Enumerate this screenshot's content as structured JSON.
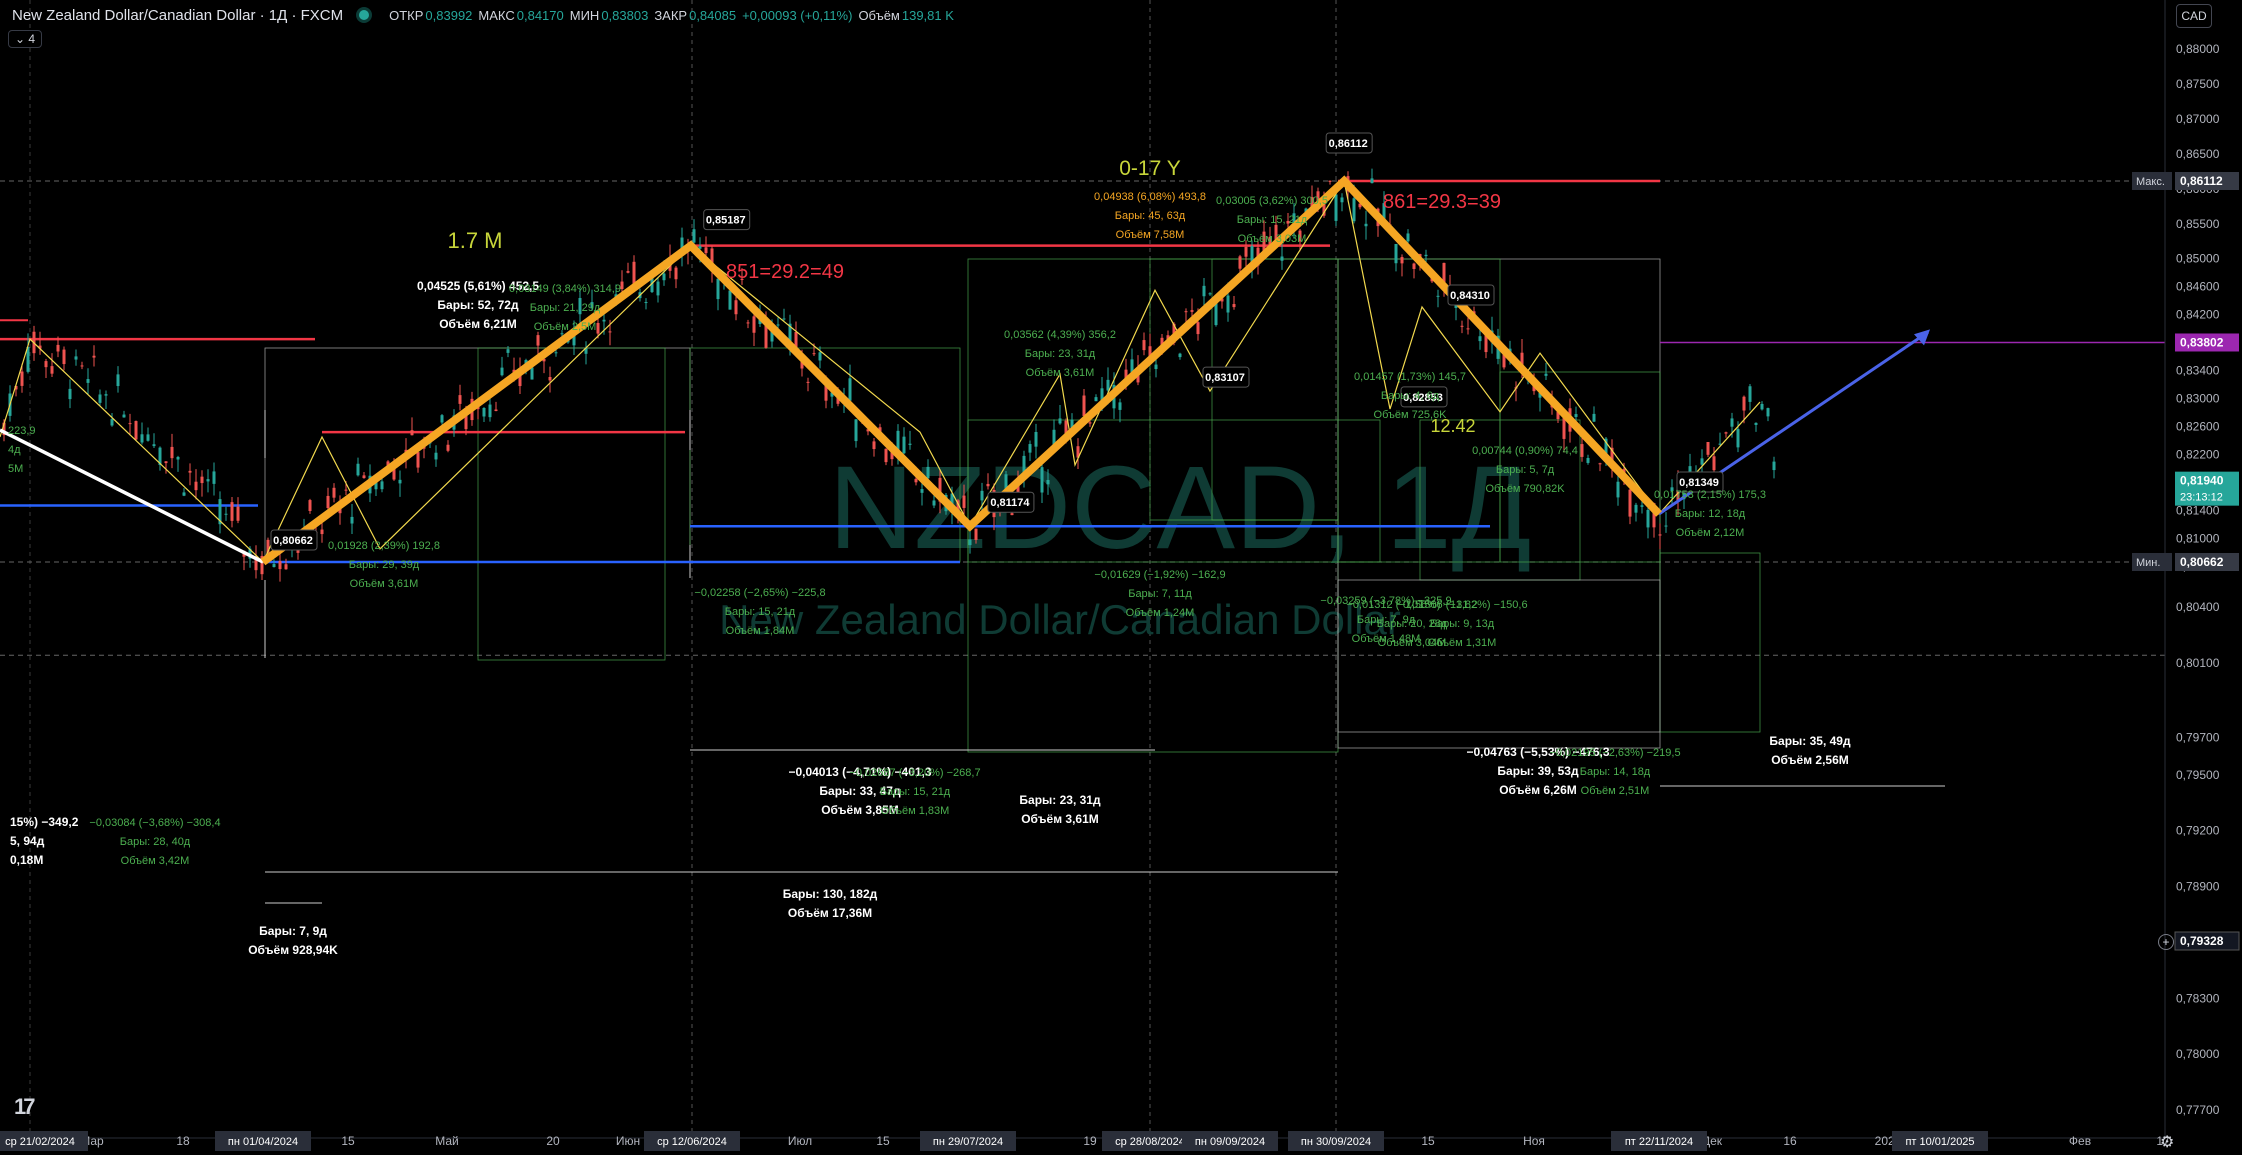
{
  "header": {
    "title": "New Zealand Dollar/Canadian Dollar · 1Д · FXCM",
    "open_label": "ОТКР",
    "open": "0,83992",
    "high_label": "МАКС",
    "high": "0,84170",
    "low_label": "МИН",
    "low": "0,83803",
    "close_label": "ЗАКР",
    "close": "0,84085",
    "change": "+0,00093 (+0,11%)",
    "volume_label": "Объём",
    "volume": "139,81 K",
    "collapse": "⌄ 4"
  },
  "currency_button": "CAD",
  "watermark": {
    "symbol": "NZDCAD, 1Д",
    "name": "New Zealand Dollar/Canadian Dollar"
  },
  "colors": {
    "zigzag": "#f5a623",
    "red_level": "#f23645",
    "blue_level": "#2962ff",
    "green": "#26a69a",
    "label_green": "#4caf50",
    "purple": "#9c27b0"
  },
  "chart_data": {
    "type": "line",
    "title": "",
    "xlabel": "",
    "ylabel": "",
    "ylim": [
      0.7705,
      0.8935
    ],
    "grid": false,
    "price_ticks": [
      "0,88000",
      "0,87500",
      "0,87000",
      "0,86500",
      "0,86000",
      "0,85500",
      "0,85000",
      "0,84600",
      "0,84200",
      "0,83800",
      "0,83400",
      "0,83000",
      "0,82600",
      "0,82200",
      "0,81800",
      "0,81400",
      "0,81000",
      "0,80600",
      "0,80400",
      "0,80100",
      "0,79700",
      "0,79500",
      "0,79200",
      "0,78900",
      "0,78600",
      "0,78300",
      "0,78000",
      "0,77700"
    ],
    "price_badges": [
      {
        "label": "Макс.",
        "value": "0,86112",
        "price": 0.86112,
        "color": "#363a45"
      },
      {
        "label": "",
        "value": "0,83802",
        "price": 0.83802,
        "color": "#9c27b0"
      },
      {
        "label": "",
        "value": "0,81940",
        "sub": "23:13:12",
        "price": 0.8194,
        "color": "#26a69a"
      },
      {
        "label": "Мин.",
        "value": "0,80662",
        "price": 0.80662,
        "color": "#363a45"
      },
      {
        "label": "",
        "value": "0,79328",
        "price": 0.79328,
        "color": "#131722"
      }
    ],
    "time_ticks": [
      "Мар",
      "18",
      "15",
      "Май",
      "20",
      "Июн",
      "Июл",
      "15",
      "19",
      "Окт",
      "15",
      "Ноя",
      "Дек",
      "16",
      "2025",
      "Фев",
      "17"
    ],
    "time_highlights": [
      "ср 21/02/2024",
      "пн 01/04/2024",
      "ср 12/06/2024",
      "пн 29/07/2024",
      "ср 28/08/2024",
      "пн 09/09/2024",
      "пн 30/09/2024",
      "пт 22/11/2024",
      "пт 10/01/2025"
    ],
    "zigzag": [
      {
        "date": "2024-04-01",
        "price": 0.80662
      },
      {
        "date": "2024-06-12",
        "price": 0.85187
      },
      {
        "date": "2024-07-29",
        "price": 0.81174
      },
      {
        "date": "2024-09-30",
        "price": 0.86112
      },
      {
        "date": "2024-11-22",
        "price": 0.81349
      }
    ],
    "pivot_labels": [
      "0,80662",
      "0,85187",
      "0,81174",
      "0,86112",
      "0,81349",
      "0,83107",
      "0,82853",
      "0,84310"
    ],
    "annotations": [
      {
        "text": "1.7 M",
        "color": "#c8d63a"
      },
      {
        "text": "0-17 Y",
        "color": "#c8d63a"
      },
      {
        "text": "851=29.2=49",
        "color": "#f23645"
      },
      {
        "text": "861=29.3=39",
        "color": "#f23645"
      },
      {
        "text": "12.42",
        "color": "#c8d63a"
      }
    ],
    "measurements": [
      {
        "lines": [
          "0,04525 (5,61%) 452,5",
          "Бары: 52, 72д",
          "Объём 6,21M"
        ],
        "color": "#ffffff"
      },
      {
        "lines": [
          "0,03149 (3,84%) 314,9",
          "Бары: 21, 29д",
          "Объём 2,5M"
        ],
        "color": "#4caf50"
      },
      {
        "lines": [
          "0,04938 (6,08%) 493,8",
          "Бары: 45, 63д",
          "Объём 7,58M"
        ],
        "color": "#f5a623"
      },
      {
        "lines": [
          "0,03005 (3,62%) 300,5",
          "Бары: 15, 21д",
          "Объём 3,03M"
        ],
        "color": "#4caf50"
      },
      {
        "lines": [
          "0,03562 (4,39%) 356,2",
          "Бары: 23, 31д",
          "Объём 3,61M"
        ],
        "color": "#4caf50"
      },
      {
        "lines": [
          "0,01928 (2,39%) 192,8",
          "Бары: 29, 39д",
          "Объём 3,61M"
        ],
        "color": "#4caf50"
      },
      {
        "lines": [
          "−0,02258 (−2,65%) −225,8",
          "Бары: 15, 21д",
          "Объём 1,84M"
        ],
        "color": "#4caf50"
      },
      {
        "lines": [
          "−0,01629 (−1,92%) −162,9",
          "Бары: 7, 11д",
          "Объём 1,24M"
        ],
        "color": "#4caf50"
      },
      {
        "lines": [
          "0,01457 (1,73%) 145,7",
          "Бары: 4, 6д",
          "Объём 725,6K"
        ],
        "color": "#4caf50"
      },
      {
        "lines": [
          "0,00744 (0,90%) 74,4",
          "Бары: 5, 7д",
          "Объём 790,82K"
        ],
        "color": "#4caf50"
      },
      {
        "lines": [
          "0,01753 (2,15%) 175,3",
          "Бары: 12, 18д",
          "Объём 2,12M"
        ],
        "color": "#4caf50"
      },
      {
        "lines": [
          "−0,03259 (−3,78%) −325,9",
          "Бары: 7, 9д",
          "Объём 1,48M"
        ],
        "color": "#4caf50"
      },
      {
        "lines": [
          "−0,01312 (−1,56%) −131,2",
          "Бары: 20, 28д",
          "Объём 3,04M"
        ],
        "color": "#4caf50"
      },
      {
        "lines": [
          "−0,01506 (−1,82%) −150,6",
          "Бары: 9, 13д",
          "Объём 1,31M"
        ],
        "color": "#4caf50"
      },
      {
        "lines": [
          "−0,04013 (−4,71%) −401,3",
          "Бары: 33, 47д",
          "Объём 3,85M"
        ],
        "color": "#ffffff"
      },
      {
        "lines": [
          "−0,02687 (−3,20%) −268,7",
          "Бары: 15, 21д",
          "Объём 1,83M"
        ],
        "color": "#4caf50"
      },
      {
        "lines": [
          "−0,04763 (−5,53%) −476,3",
          "Бары: 39, 53д",
          "Объём 6,26M"
        ],
        "color": "#ffffff"
      },
      {
        "lines": [
          "−0,02195 (−2,63%) −219,5",
          "Бары: 14, 18д",
          "Объём 2,51M"
        ],
        "color": "#4caf50"
      },
      {
        "lines": [
          "Бары: 23, 31д",
          "Объём 3,61M"
        ],
        "color": "#ffffff"
      },
      {
        "lines": [
          "Бары: 130, 182д",
          "Объём 17,36M"
        ],
        "color": "#ffffff"
      },
      {
        "lines": [
          "Бары: 7, 9д",
          "Объём 928,94K"
        ],
        "color": "#ffffff"
      },
      {
        "lines": [
          "Бары: 35, 49д",
          "Объём 2,56M"
        ],
        "color": "#ffffff"
      },
      {
        "lines": [
          "−0,03084 (−3,68%) −308,4",
          "Бары: 28, 40д",
          "Объём 3,42M"
        ],
        "color": "#4caf50"
      },
      {
        "lines": [
          "15%) −349,2",
          "5, 94д",
          "0,18M"
        ],
        "color": "#ffffff"
      },
      {
        "lines": [
          "223,9",
          "4д",
          "5M"
        ],
        "color": "#4caf50"
      }
    ]
  }
}
